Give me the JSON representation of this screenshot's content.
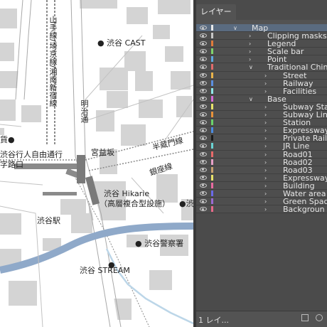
{
  "map": {
    "labels": {
      "cast": "● 渋谷 CAST",
      "yamanote": "山手線/埼京線/湘南新宿線",
      "meiji": "明治通",
      "miyamasu": "宮益坂",
      "hanzomon": "半蔵門線",
      "ginza": "銀座線",
      "crossing_top": "渋谷行人自由通行",
      "crossing_bottom": "字路口",
      "store": "貨●",
      "hikarie_1": "渋谷 Hikarie",
      "hikarie_2": "（高層複合型設施）",
      "partial_right": "●渋",
      "station": "渋谷駅",
      "police": "● 渋谷警察署",
      "stream": "渋谷 STREAM",
      "stream_dot": "●"
    }
  },
  "panel": {
    "title": "レイヤー",
    "footer_count": "1 レイ...",
    "layers": [
      {
        "label": "Map",
        "level": 0,
        "color": "#e8e8e8",
        "expanded": true,
        "selected": true
      },
      {
        "label": "Clipping masks",
        "level": 1,
        "color": "#c6c6c6",
        "expanded": false
      },
      {
        "label": "Legend",
        "level": 1,
        "color": "#e07b3a",
        "expanded": false
      },
      {
        "label": "Scale bar",
        "level": 1,
        "color": "#7fd36a",
        "expanded": false
      },
      {
        "label": "Point",
        "level": 1,
        "color": "#5fa8e0",
        "expanded": false
      },
      {
        "label": "Traditional Chin",
        "level": 1,
        "color": "#e06b6b",
        "expanded": true
      },
      {
        "label": "Street",
        "level": 2,
        "color": "#e8b34a",
        "expanded": false
      },
      {
        "label": "Railway",
        "level": 2,
        "color": "#5b8fe0",
        "expanded": false
      },
      {
        "label": "Facilities",
        "level": 2,
        "color": "#8ee8e8",
        "expanded": false
      },
      {
        "label": "Base",
        "level": 1,
        "color": "#d66bd6",
        "expanded": true
      },
      {
        "label": "Subway Sta",
        "level": 2,
        "color": "#e8e26a",
        "expanded": false
      },
      {
        "label": "Subway Lin",
        "level": 2,
        "color": "#e8923a",
        "expanded": false
      },
      {
        "label": "Station",
        "level": 2,
        "color": "#6ad36a",
        "expanded": false
      },
      {
        "label": "Expressway",
        "level": 2,
        "color": "#4a8ae0",
        "expanded": false
      },
      {
        "label": "Private Rail",
        "level": 2,
        "color": "#1a1a1a",
        "expanded": false
      },
      {
        "label": "JR Line",
        "level": 2,
        "color": "#6ad3d3",
        "expanded": false
      },
      {
        "label": "Road01",
        "level": 2,
        "color": "#e86a6a",
        "expanded": false
      },
      {
        "label": "Road02",
        "level": 2,
        "color": "#e8a0c8",
        "expanded": false
      },
      {
        "label": "Road03",
        "level": 2,
        "color": "#c8a070",
        "expanded": false
      },
      {
        "label": "Expressway",
        "level": 2,
        "color": "#e8e26a",
        "expanded": false
      },
      {
        "label": "Building",
        "level": 2,
        "color": "#e86aa0",
        "expanded": false
      },
      {
        "label": "Water area",
        "level": 2,
        "color": "#6a6ae8",
        "expanded": false
      },
      {
        "label": "Green Spac",
        "level": 2,
        "color": "#9a6ad3",
        "expanded": false
      },
      {
        "label": "Backgroun",
        "level": 2,
        "color": "#e86a8a",
        "expanded": false
      }
    ]
  }
}
